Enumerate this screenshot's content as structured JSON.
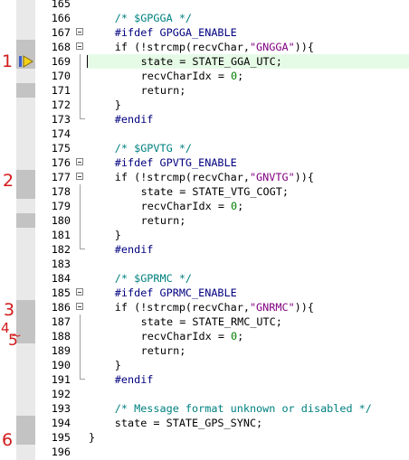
{
  "editor": {
    "lines": [
      {
        "num": "165",
        "parts": []
      },
      {
        "num": "166",
        "indent": 2,
        "parts": [
          {
            "t": "cm",
            "v": "/* $GPGGA */"
          }
        ]
      },
      {
        "num": "167",
        "indent": 2,
        "parts": [
          {
            "t": "pp",
            "v": "#ifdef GPGGA_ENABLE"
          }
        ]
      },
      {
        "num": "168",
        "indent": 2,
        "parts": [
          {
            "t": "",
            "v": "if (!strcmp(recvChar,"
          },
          {
            "t": "str",
            "v": "\"GNGGA\""
          },
          {
            "t": "",
            "v": ")){"
          }
        ]
      },
      {
        "num": "169",
        "indent": 4,
        "parts": [
          {
            "t": "",
            "v": "state = STATE_GGA_UTC;"
          }
        ]
      },
      {
        "num": "170",
        "indent": 4,
        "parts": [
          {
            "t": "",
            "v": "recvCharIdx = "
          },
          {
            "t": "num",
            "v": "0"
          },
          {
            "t": "",
            "v": ";"
          }
        ]
      },
      {
        "num": "171",
        "indent": 4,
        "parts": [
          {
            "t": "",
            "v": "return;"
          }
        ]
      },
      {
        "num": "172",
        "indent": 2,
        "parts": [
          {
            "t": "",
            "v": "}"
          }
        ]
      },
      {
        "num": "173",
        "indent": 2,
        "parts": [
          {
            "t": "pp",
            "v": "#endif"
          }
        ]
      },
      {
        "num": "174",
        "parts": []
      },
      {
        "num": "175",
        "indent": 2,
        "parts": [
          {
            "t": "cm",
            "v": "/* $GPVTG */"
          }
        ]
      },
      {
        "num": "176",
        "indent": 2,
        "parts": [
          {
            "t": "pp",
            "v": "#ifdef GPVTG_ENABLE"
          }
        ]
      },
      {
        "num": "177",
        "indent": 2,
        "parts": [
          {
            "t": "",
            "v": "if (!strcmp(recvChar,"
          },
          {
            "t": "str",
            "v": "\"GNVTG\""
          },
          {
            "t": "",
            "v": ")){"
          }
        ]
      },
      {
        "num": "178",
        "indent": 4,
        "parts": [
          {
            "t": "",
            "v": "state = STATE_VTG_COGT;"
          }
        ]
      },
      {
        "num": "179",
        "indent": 4,
        "parts": [
          {
            "t": "",
            "v": "recvCharIdx = "
          },
          {
            "t": "num",
            "v": "0"
          },
          {
            "t": "",
            "v": ";"
          }
        ]
      },
      {
        "num": "180",
        "indent": 4,
        "parts": [
          {
            "t": "",
            "v": "return;"
          }
        ]
      },
      {
        "num": "181",
        "indent": 2,
        "parts": [
          {
            "t": "",
            "v": "}"
          }
        ]
      },
      {
        "num": "182",
        "indent": 2,
        "parts": [
          {
            "t": "pp",
            "v": "#endif"
          }
        ]
      },
      {
        "num": "183",
        "parts": []
      },
      {
        "num": "184",
        "indent": 2,
        "parts": [
          {
            "t": "cm",
            "v": "/* $GPRMC */"
          }
        ]
      },
      {
        "num": "185",
        "indent": 2,
        "parts": [
          {
            "t": "pp",
            "v": "#ifdef GPRMC_ENABLE"
          }
        ]
      },
      {
        "num": "186",
        "indent": 2,
        "parts": [
          {
            "t": "",
            "v": "if (!strcmp(recvChar,"
          },
          {
            "t": "str",
            "v": "\"GNRMC\""
          },
          {
            "t": "",
            "v": ")){"
          }
        ]
      },
      {
        "num": "187",
        "indent": 4,
        "parts": [
          {
            "t": "",
            "v": "state = STATE_RMC_UTC;"
          }
        ]
      },
      {
        "num": "188",
        "indent": 4,
        "parts": [
          {
            "t": "",
            "v": "recvCharIdx = "
          },
          {
            "t": "num",
            "v": "0"
          },
          {
            "t": "",
            "v": ";"
          }
        ]
      },
      {
        "num": "189",
        "indent": 4,
        "parts": [
          {
            "t": "",
            "v": "return;"
          }
        ]
      },
      {
        "num": "190",
        "indent": 2,
        "parts": [
          {
            "t": "",
            "v": "}"
          }
        ]
      },
      {
        "num": "191",
        "indent": 2,
        "parts": [
          {
            "t": "pp",
            "v": "#endif"
          }
        ]
      },
      {
        "num": "192",
        "parts": []
      },
      {
        "num": "193",
        "indent": 2,
        "parts": [
          {
            "t": "cm",
            "v": "/* Message format unknown or disabled */"
          }
        ]
      },
      {
        "num": "194",
        "indent": 2,
        "parts": [
          {
            "t": "",
            "v": "state = STATE_GPS_SYNC;"
          }
        ]
      },
      {
        "num": "195",
        "indent": 0,
        "parts": [
          {
            "t": "",
            "v": "}"
          }
        ]
      },
      {
        "num": "196",
        "parts": []
      }
    ],
    "current_line": "169",
    "breakpoint_lines": [
      "168",
      "169",
      "171",
      "177",
      "178",
      "180",
      "186",
      "187",
      "188",
      "194",
      "195"
    ],
    "fold_open_lines": [
      "167",
      "168",
      "176",
      "177",
      "185",
      "186"
    ],
    "colors": {
      "comment": "#008080",
      "preprocessor": "#000080",
      "string": "#800080",
      "number": "#008000",
      "current_line_bg": "#e6fbe6",
      "gutter_bg": "#e9e9e9",
      "gutter_mark": "#c3c3c3",
      "annotation": "#d11a1a"
    },
    "icons": {
      "current_line_marker": "yellow-arrow-icon"
    }
  },
  "annotations": [
    {
      "text": "1"
    },
    {
      "text": "2"
    },
    {
      "text": "3"
    },
    {
      "text": "4"
    },
    {
      "text": "5"
    },
    {
      "text": "6"
    }
  ]
}
